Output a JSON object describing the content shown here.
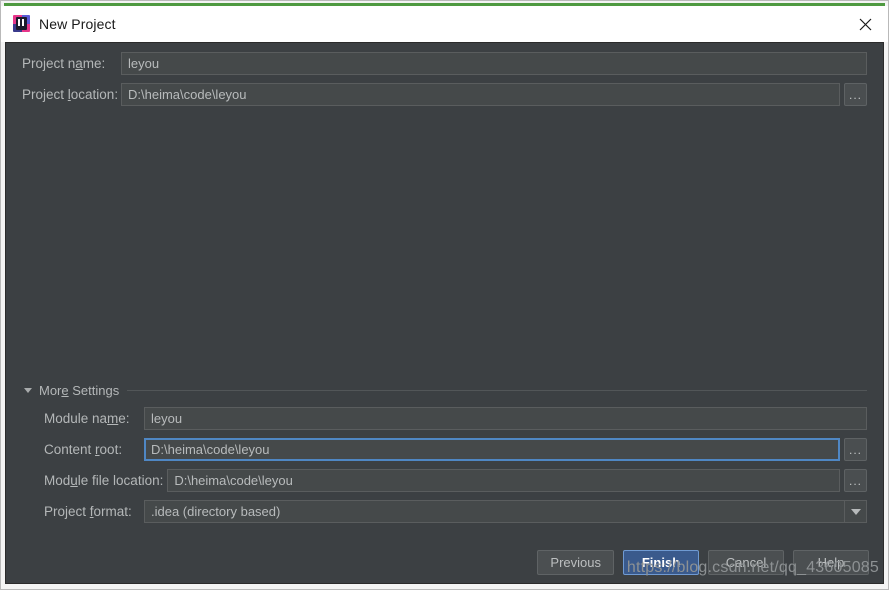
{
  "window": {
    "title": "New Project",
    "app_icon": "intellij-idea-icon",
    "close_icon": "close-icon",
    "accent_color": "#4f9a41",
    "panel_bg": "#3c4043",
    "focus_border_color": "#4f87c4",
    "primary_button_color": "#3a5a8c"
  },
  "top_fields": [
    {
      "label_pre": "Project n",
      "label_mnemonic": "a",
      "label_post": "me:",
      "value": "leyou",
      "has_browse": false,
      "name": "project-name"
    },
    {
      "label_pre": "Project ",
      "label_mnemonic": "l",
      "label_post": "ocation:",
      "value": "D:\\heima\\code\\leyou",
      "has_browse": true,
      "name": "project-location"
    }
  ],
  "more_settings": {
    "label_pre": "Mor",
    "label_mnemonic": "e",
    "label_post": " Settings",
    "expanded": true,
    "toggle_icon": "chevron-down-icon"
  },
  "more_fields": [
    {
      "label_pre": "Module na",
      "label_mnemonic": "m",
      "label_post": "e:",
      "value": "leyou",
      "name": "module-name"
    },
    {
      "label_pre": "Content ",
      "label_mnemonic": "r",
      "label_post": "oot:",
      "value": "D:\\heima\\code\\leyou",
      "name": "content-root"
    },
    {
      "label_pre": "Mod",
      "label_mnemonic": "u",
      "label_post": "le file location:",
      "value": "D:\\heima\\code\\leyou",
      "name": "module-file-location"
    },
    {
      "label_pre": "Project ",
      "label_mnemonic": "f",
      "label_post": "ormat:",
      "value": ".idea (directory based)",
      "name": "project-format"
    }
  ],
  "browse_button_label": "...",
  "buttons": [
    {
      "label": "Previous",
      "name": "previous-button",
      "primary": false
    },
    {
      "label": "Finish",
      "name": "finish-button",
      "primary": true
    },
    {
      "label": "Cancel",
      "name": "cancel-button",
      "primary": false
    },
    {
      "label": "Help",
      "name": "help-button",
      "primary": false
    }
  ],
  "watermark": "https://blog.csdn.net/qq_43605085"
}
